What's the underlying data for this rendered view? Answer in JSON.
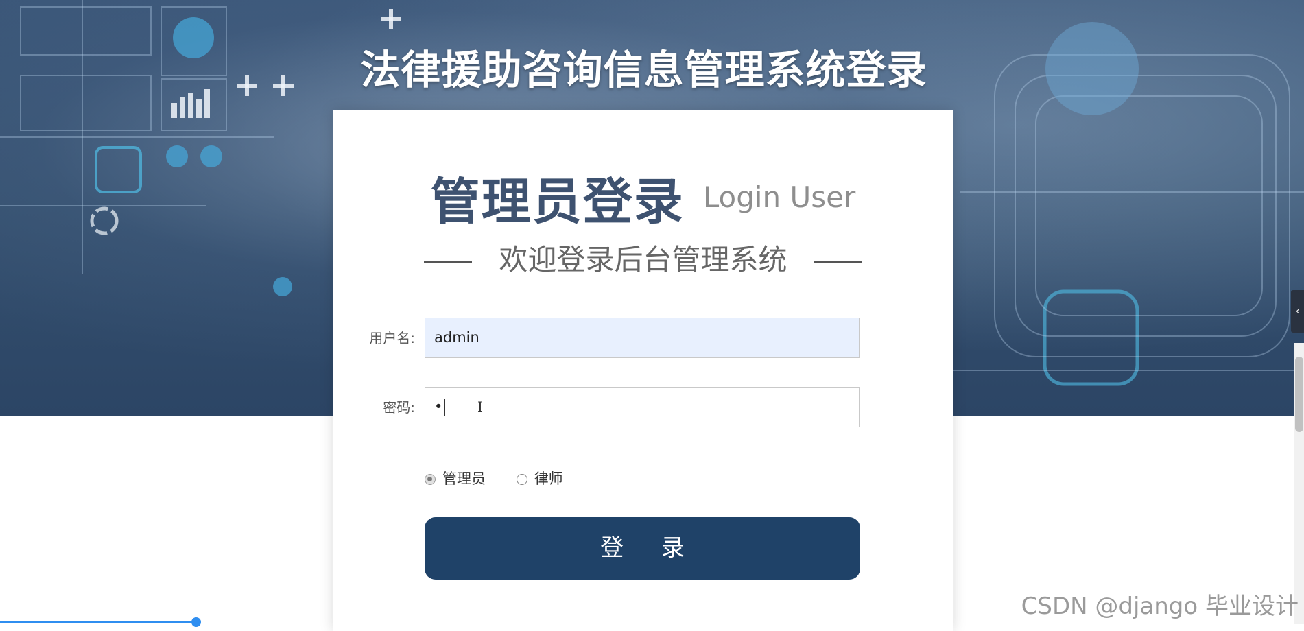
{
  "page": {
    "title": "法律援助咨询信息管理系统登录"
  },
  "card": {
    "heading": "管理员登录",
    "heading_en": "Login User",
    "subtitle": "欢迎登录后台管理系统"
  },
  "form": {
    "username": {
      "label": "用户名:",
      "value": "admin"
    },
    "password": {
      "label": "密码:",
      "value": "•"
    },
    "roles": [
      {
        "label": "管理员",
        "checked": true
      },
      {
        "label": "律师",
        "checked": false
      }
    ],
    "submit_label": "登 录"
  },
  "side_handle": {
    "icon": "chevron-left-icon",
    "glyph": "‹"
  },
  "watermark": "CSDN @django 毕业设计",
  "colors": {
    "button": "#1f4268",
    "heading": "#3e5270",
    "username_bg": "#e8f0fe"
  }
}
